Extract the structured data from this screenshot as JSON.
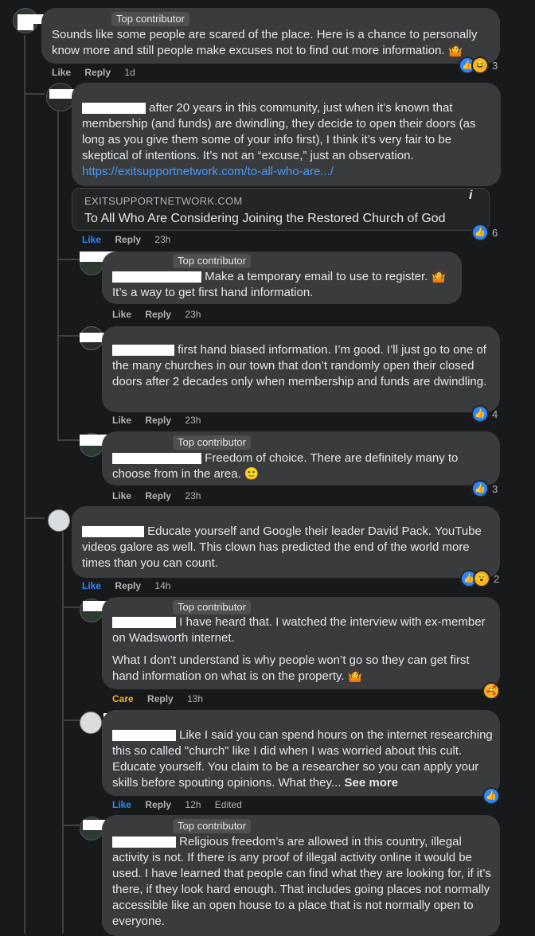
{
  "badges": {
    "top_contributor": "Top contributor"
  },
  "actions": {
    "like": "Like",
    "reply": "Reply",
    "care": "Care",
    "edited": "Edited"
  },
  "comments": [
    {
      "text": "Sounds like some people are scared of the place. Here is a chance to personally know more and still people make excuses not to find out more information. 🤷",
      "time": "1d",
      "reaction_count": "3"
    },
    {
      "text_suffix": "after 20 years in this community, just when it’s known that membership (and funds) are dwindling, they decide to open their doors (as long as you give them some of your info first), I think it’s very fair to be skeptical of intentions. It’s not an “excuse,” just an observation.",
      "link": "https://exitsupportnetwork.com/to-all-who-are.../",
      "preview_domain": "EXITSUPPORTNETWORK.COM",
      "preview_title": "To All Who Are Considering Joining the Restored Church of God",
      "preview_info_icon": "i",
      "time": "23h",
      "reaction_count": "6"
    },
    {
      "text_suffix": "Make a temporary email to use to register. 🤷",
      "text_line2": "It’s a way to get first hand information.",
      "time": "23h"
    },
    {
      "text_suffix": "first hand biased information. I’m good. I’ll just go to one of the many churches in our town that don’t randomly open their closed doors after 2 decades only when membership and funds are dwindling.",
      "time": "23h",
      "reaction_count": "4"
    },
    {
      "text_suffix": "Freedom of choice. There are definitely many to choose from in the area. 🙂",
      "time": "23h",
      "reaction_count": "3"
    },
    {
      "text_suffix": "Educate yourself and Google their leader David Pack. YouTube videos galore as well. This clown has predicted the end of the world more times than you can count.",
      "time": "14h",
      "reaction_count": "2"
    },
    {
      "text_suffix": "I have heard that. I watched the interview with ex-member on Wadsworth internet.",
      "text_para2": "What I don’t understand is why people won’t go so they can get first hand information on what is on the property. 🤷",
      "time": "13h"
    },
    {
      "text_suffix": "Like I said you can spend hours on the internet researching this so called \"church\" like I did when I was worried about this cult. Educate yourself. You claim to be a researcher so you can apply your skills before spouting opinions. What they...",
      "see_more": "See more",
      "time": "12h"
    },
    {
      "text_suffix": "Religious freedom’s are allowed in this country, illegal activity is not. If there is any proof of illegal activity online it would be used. I have learned that people can find what they are looking for, if it’s there, if they look hard enough. That includes going places not normally accessible like an open house to a place that is not normally open to everyone."
    }
  ],
  "icons": {
    "like": "👍",
    "haha": "😆",
    "wow": "😮",
    "care": "🥰"
  },
  "colors": {
    "background": "#18191a",
    "bubble": "#3a3b3c",
    "link": "#4599ff",
    "like": "#2d88ff",
    "care": "#f7b125"
  }
}
